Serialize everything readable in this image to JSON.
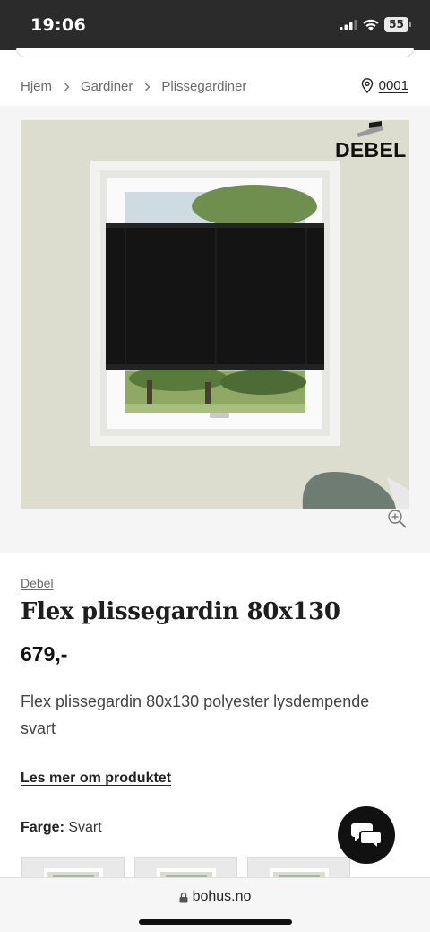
{
  "status_bar": {
    "time": "19:06",
    "battery": "55",
    "icons": [
      "signal-icon",
      "wifi-icon",
      "battery-icon"
    ]
  },
  "breadcrumb": {
    "items": [
      "Hjem",
      "Gardiner",
      "Plissegardiner"
    ],
    "separator_icon": "chevron-right-icon"
  },
  "store": {
    "code": "0001",
    "icon": "location-pin-icon"
  },
  "gallery": {
    "logo_text": "DEBEL",
    "zoom_icon": "zoom-in-icon"
  },
  "product": {
    "brand": "Debel",
    "title": "Flex plissegardin 80x130",
    "price": "679,-",
    "description": "Flex plissegardin 80x130 polyester lysdempende svart",
    "read_more": "Les mer om produktet",
    "color_label": "Farge:",
    "color_value": "Svart"
  },
  "chat": {
    "icon": "chat-bubbles-icon"
  },
  "browser": {
    "url": "bohus.no",
    "icon": "lock-icon"
  },
  "colors": {
    "status_bar_bg": "#2b2b2b",
    "gallery_bg": "#f5f5f5",
    "blind": "#141414",
    "wall": "#dcdccf",
    "chat_button": "#111111"
  }
}
